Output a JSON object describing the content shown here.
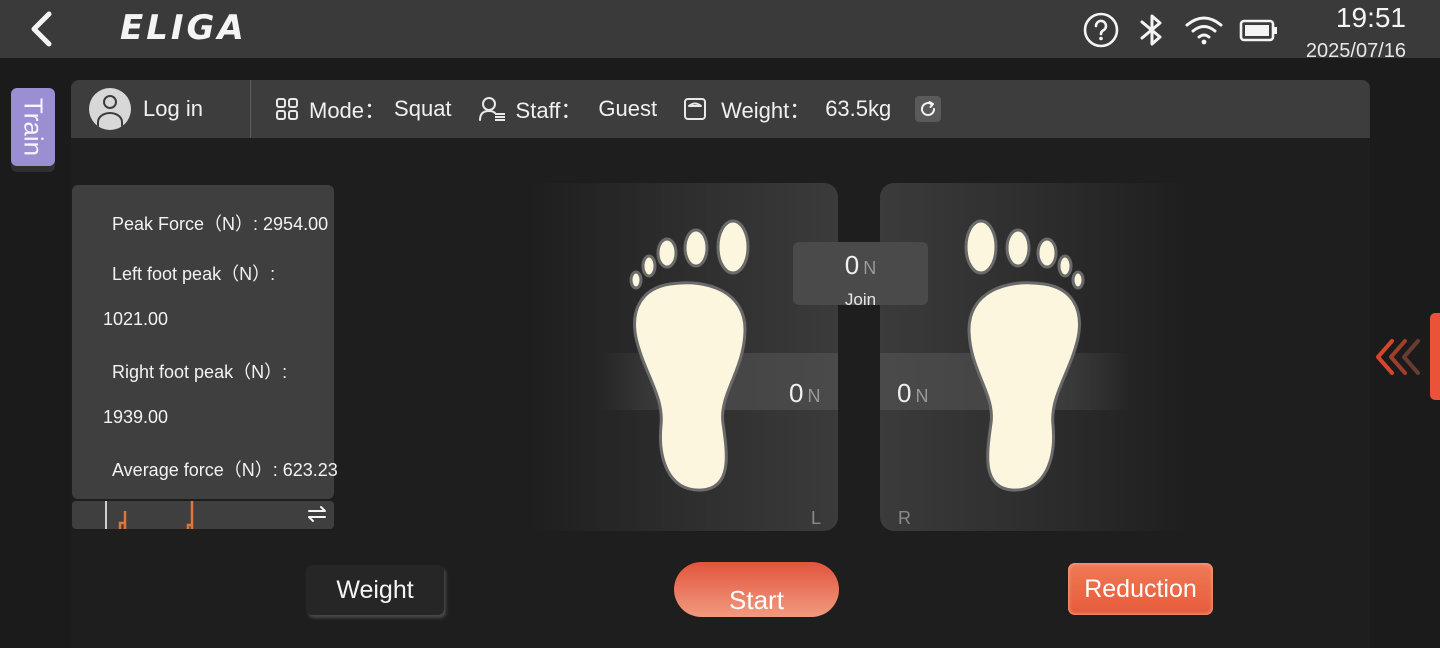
{
  "header": {
    "logo": "ELIGA",
    "time": "19:51",
    "date": "2025/07/16",
    "icons": [
      "back-arrow-icon",
      "help-icon",
      "bluetooth-icon",
      "wifi-icon",
      "battery-icon"
    ]
  },
  "side_tab": {
    "label": "Train"
  },
  "infobar": {
    "login": "Log in",
    "mode_label": "Mode：",
    "mode_value": "Squat",
    "staff_label": "Staff：",
    "staff_value": "Guest",
    "weight_label": "Weight：",
    "weight_value": "63.5kg"
  },
  "stats": {
    "peak_force": "Peak Force（N）: 2954.00",
    "left_peak_label": "Left foot peak（N）:",
    "left_peak_value": "1021.00",
    "right_peak_label": "Right foot peak（N）:",
    "right_peak_value": "1939.00",
    "average_force": "Average force（N）: 623.23"
  },
  "pads": {
    "left_value": "0",
    "right_value": "0",
    "join_value": "0",
    "unit": "N",
    "join_label": "Join",
    "left_side": "L",
    "right_side": "R"
  },
  "buttons": {
    "weight": "Weight",
    "start": "Start",
    "reduction": "Reduction"
  },
  "colors": {
    "accent": "#e8533a",
    "train_tab": "#9b8ed3",
    "foot_fill": "#fdf6df",
    "foot_stroke": "#6a6a6a"
  }
}
